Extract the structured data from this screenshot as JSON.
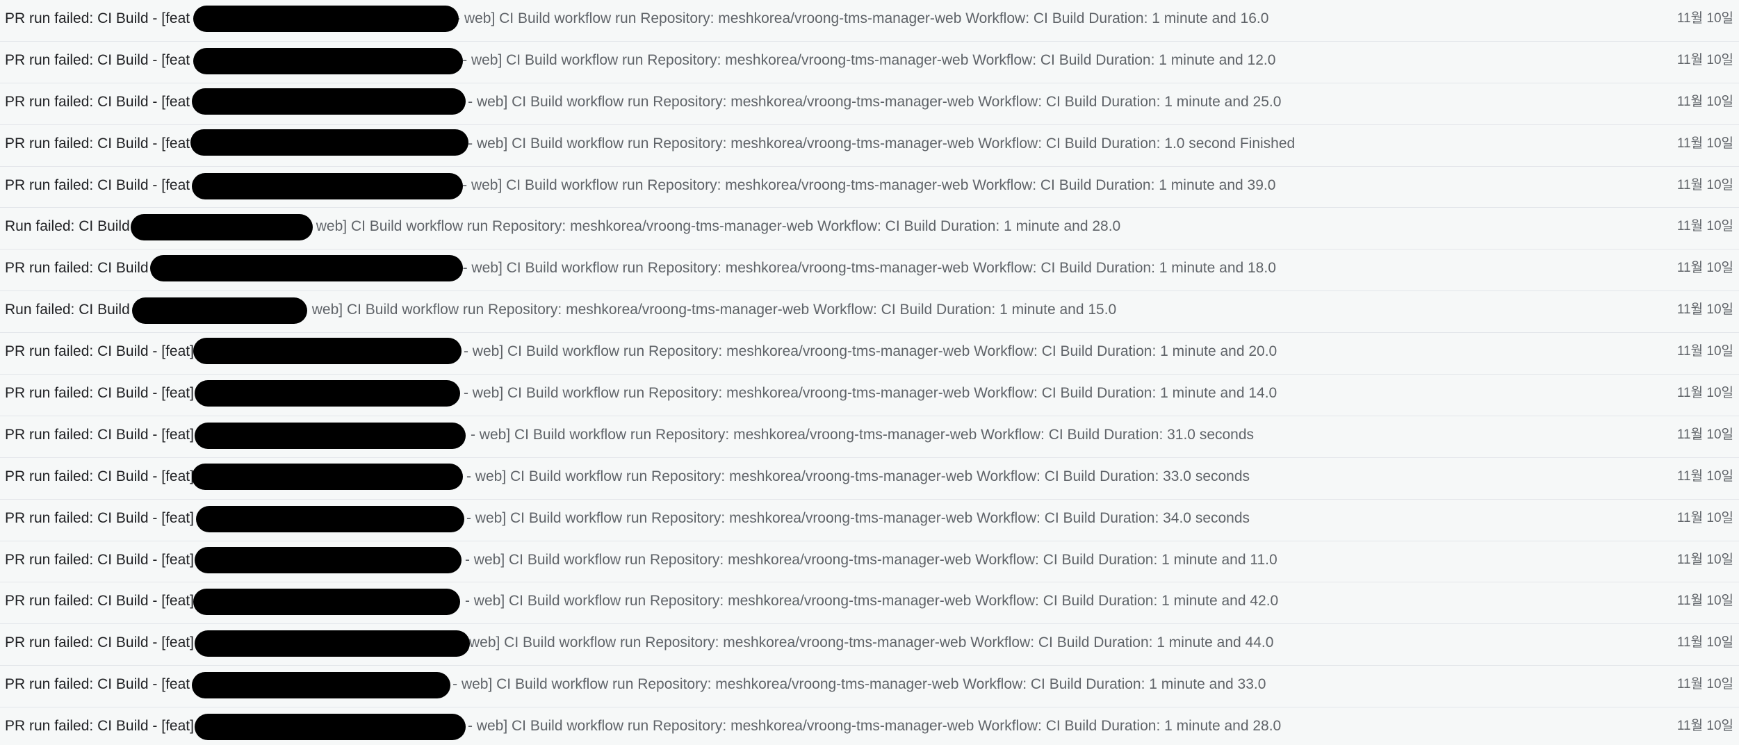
{
  "emails": [
    {
      "subject": "PR run failed: CI Build - [feat",
      "snippet": "- web] CI Build workflow run Repository: meshkorea/vroong-tms-manager-web Workflow: CI Build Duration: 1 minute and 16.0",
      "date": "11월 10일"
    },
    {
      "subject": "PR run failed: CI Build - [feat",
      "snippet": "- web] CI Build workflow run Repository: meshkorea/vroong-tms-manager-web Workflow: CI Build Duration: 1 minute and 12.0",
      "date": "11월 10일"
    },
    {
      "subject": "PR run failed: CI Build - [feat",
      "snippet": "- web] CI Build workflow run Repository: meshkorea/vroong-tms-manager-web Workflow: CI Build Duration: 1 minute and 25.0",
      "date": "11월 10일"
    },
    {
      "subject": "PR run failed: CI Build - [feat",
      "snippet": "- web] CI Build workflow run Repository: meshkorea/vroong-tms-manager-web Workflow: CI Build Duration: 1.0 second Finished",
      "date": "11월 10일"
    },
    {
      "subject": "PR run failed: CI Build - [feat",
      "snippet": "- web] CI Build workflow run Repository: meshkorea/vroong-tms-manager-web Workflow: CI Build Duration: 1 minute and 39.0",
      "date": "11월 10일"
    },
    {
      "subject": "Run failed: CI Build",
      "snippet": "web] CI Build workflow run Repository: meshkorea/vroong-tms-manager-web Workflow: CI Build Duration: 1 minute and 28.0",
      "date": "11월 10일"
    },
    {
      "subject": "PR run failed: CI Build",
      "snippet": "- web] CI Build workflow run Repository: meshkorea/vroong-tms-manager-web Workflow: CI Build Duration: 1 minute and 18.0",
      "date": "11월 10일"
    },
    {
      "subject": "Run failed: CI Build",
      "snippet": "web] CI Build workflow run Repository: meshkorea/vroong-tms-manager-web Workflow: CI Build Duration: 1 minute and 15.0",
      "date": "11월 10일"
    },
    {
      "subject": "PR run failed: CI Build - [feat]",
      "snippet": "- web] CI Build workflow run Repository: meshkorea/vroong-tms-manager-web Workflow: CI Build Duration: 1 minute and 20.0",
      "date": "11월 10일"
    },
    {
      "subject": "PR run failed: CI Build - [feat]",
      "snippet": "- web] CI Build workflow run Repository: meshkorea/vroong-tms-manager-web Workflow: CI Build Duration: 1 minute and 14.0",
      "date": "11월 10일"
    },
    {
      "subject": "PR run failed: CI Build - [feat]",
      "snippet": "- web] CI Build workflow run Repository: meshkorea/vroong-tms-manager-web Workflow: CI Build Duration: 31.0 seconds",
      "date": "11월 10일"
    },
    {
      "subject": "PR run failed: CI Build - [feat]",
      "snippet": "- web] CI Build workflow run Repository: meshkorea/vroong-tms-manager-web Workflow: CI Build Duration: 33.0 seconds",
      "date": "11월 10일"
    },
    {
      "subject": "PR run failed: CI Build - [feat]",
      "snippet": "- web] CI Build workflow run Repository: meshkorea/vroong-tms-manager-web Workflow: CI Build Duration: 34.0 seconds",
      "date": "11월 10일"
    },
    {
      "subject": "PR run failed: CI Build - [feat]",
      "snippet": "- web] CI Build workflow run Repository: meshkorea/vroong-tms-manager-web Workflow: CI Build Duration: 1 minute and 11.0",
      "date": "11월 10일"
    },
    {
      "subject": "PR run failed: CI Build - [feat]",
      "snippet": "- web] CI Build workflow run Repository: meshkorea/vroong-tms-manager-web Workflow: CI Build Duration: 1 minute and 42.0",
      "date": "11월 10일"
    },
    {
      "subject": "PR run failed: CI Build - [feat]",
      "snippet": "web] CI Build workflow run Repository: meshkorea/vroong-tms-manager-web Workflow: CI Build Duration: 1 minute and 44.0",
      "date": "11월 10일"
    },
    {
      "subject": "PR run failed: CI Build - [feat",
      "snippet": "- web] CI Build workflow run Repository: meshkorea/vroong-tms-manager-web Workflow: CI Build Duration: 1 minute and 33.0",
      "date": "11월 10일"
    },
    {
      "subject": "PR run failed: CI Build - [feat]",
      "snippet": "- web] CI Build workflow run Repository: meshkorea/vroong-tms-manager-web Workflow: CI Build Duration: 1 minute and 28.0",
      "date": "11월 10일"
    }
  ]
}
